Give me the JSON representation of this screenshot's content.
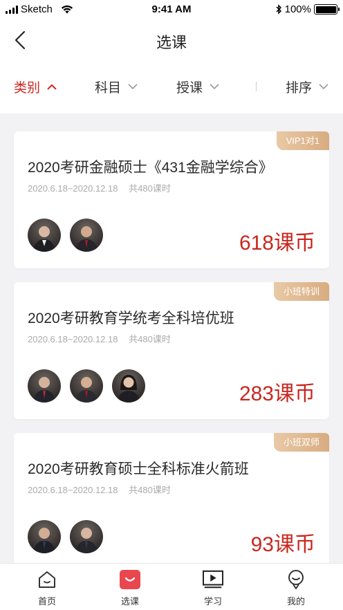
{
  "status_bar": {
    "carrier": "Sketch",
    "time": "9:41 AM",
    "battery": "100%"
  },
  "nav": {
    "title": "选课"
  },
  "filters": [
    {
      "label": "类别",
      "active": true
    },
    {
      "label": "科目",
      "active": false
    },
    {
      "label": "授课",
      "active": false
    },
    {
      "label": "排序",
      "active": false
    }
  ],
  "courses": [
    {
      "badge": "VIP1对1",
      "title": "2020考研金融硕士《431金融学综合》",
      "dates": "2020.6.18~2020.12.18",
      "hours": "共480课时",
      "teacher_count": 2,
      "price": "618课币"
    },
    {
      "badge": "小班特训",
      "title": "2020考研教育学统考全科培优班",
      "dates": "2020.6.18~2020.12.18",
      "hours": "共480课时",
      "teacher_count": 3,
      "price": "283课币"
    },
    {
      "badge": "小班双师",
      "title": "2020考研教育硕士全科标准火箭班",
      "dates": "2020.6.18~2020.12.18",
      "hours": "共480课时",
      "teacher_count": 2,
      "price": "93课币"
    }
  ],
  "tabs": [
    {
      "label": "首页",
      "icon": "home-icon"
    },
    {
      "label": "选课",
      "icon": "course-select-icon",
      "active": true
    },
    {
      "label": "学习",
      "icon": "video-icon"
    },
    {
      "label": "我的",
      "icon": "profile-icon"
    }
  ],
  "colors": {
    "accent": "#d0271d",
    "price": "#c8271f",
    "badge": "#dcb186"
  }
}
